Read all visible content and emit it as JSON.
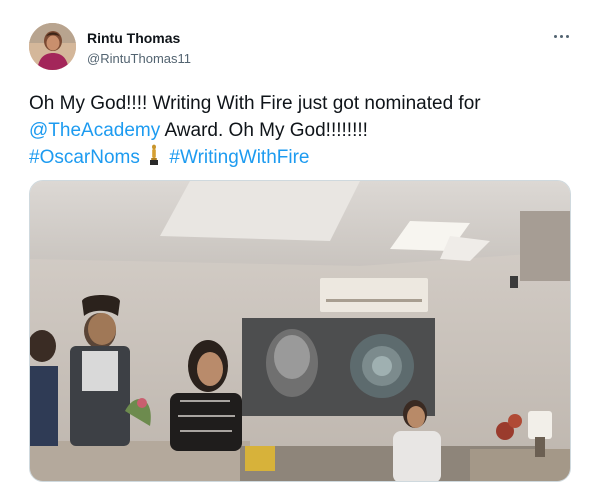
{
  "user": {
    "name": "Rintu Thomas",
    "handle": "@RintuThomas11",
    "avatar_icon": "profile-photo"
  },
  "more_icon": "more-horizontal-icon",
  "tweet": {
    "line1": "Oh My God!!!! Writing With Fire just got nominated for",
    "mention": "@TheAcademy",
    "line2_rest": " Award. Oh My God!!!!!!!!",
    "hashtag1": "#OscarNoms",
    "emoji": "trophy-icon",
    "hashtag2": "#WritingWithFire"
  },
  "media": {
    "type": "photo",
    "description_icon": "photo-media"
  },
  "colors": {
    "link": "#1d9bf0",
    "text": "#0f1419",
    "secondary": "#536471",
    "border": "#cfd9de"
  }
}
